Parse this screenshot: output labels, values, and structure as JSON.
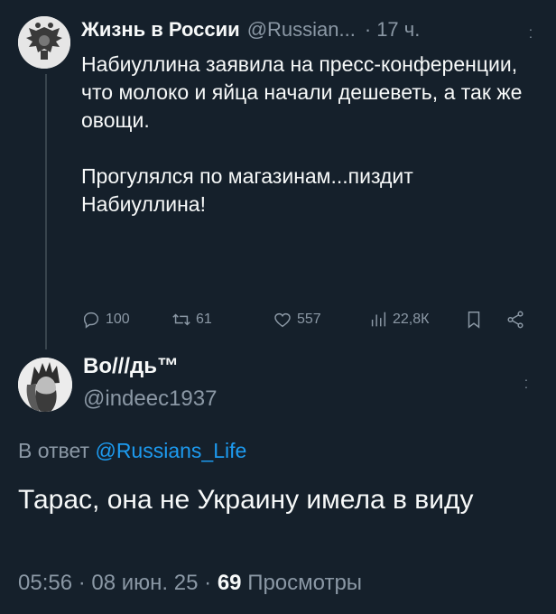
{
  "tweet1": {
    "author_name": "Жизнь в России",
    "handle": "@Russian...",
    "separator": "·",
    "time": "17 ч.",
    "text": "Набиуллина заявила на пресс-конференции, что молоко и яйца начали дешеветь, а так же овощи.\n\nПрогулялся по магазинам...пиздит Набиуллина!",
    "replies": "100",
    "retweets": "61",
    "likes": "557",
    "views": "22,8К"
  },
  "tweet2": {
    "author_name": "Во///дь™",
    "handle": "@indeec1937",
    "reply_prefix": "В ответ",
    "reply_to": "@Russians_Life",
    "text": "Тарас, она не Украину имела в виду",
    "time": "05:56",
    "date": "08 июн. 25",
    "separator": "·",
    "views_count": "69",
    "views_label": "Просмотры"
  },
  "icons": {
    "reply": "reply-icon",
    "retweet": "retweet-icon",
    "like": "heart-icon",
    "views": "analytics-icon",
    "bookmark": "bookmark-icon",
    "share": "share-icon",
    "more": "more-icon"
  },
  "colors": {
    "background": "#15202b",
    "text": "#f7f9f9",
    "muted": "#8b98a5",
    "link": "#1d9bf0"
  }
}
